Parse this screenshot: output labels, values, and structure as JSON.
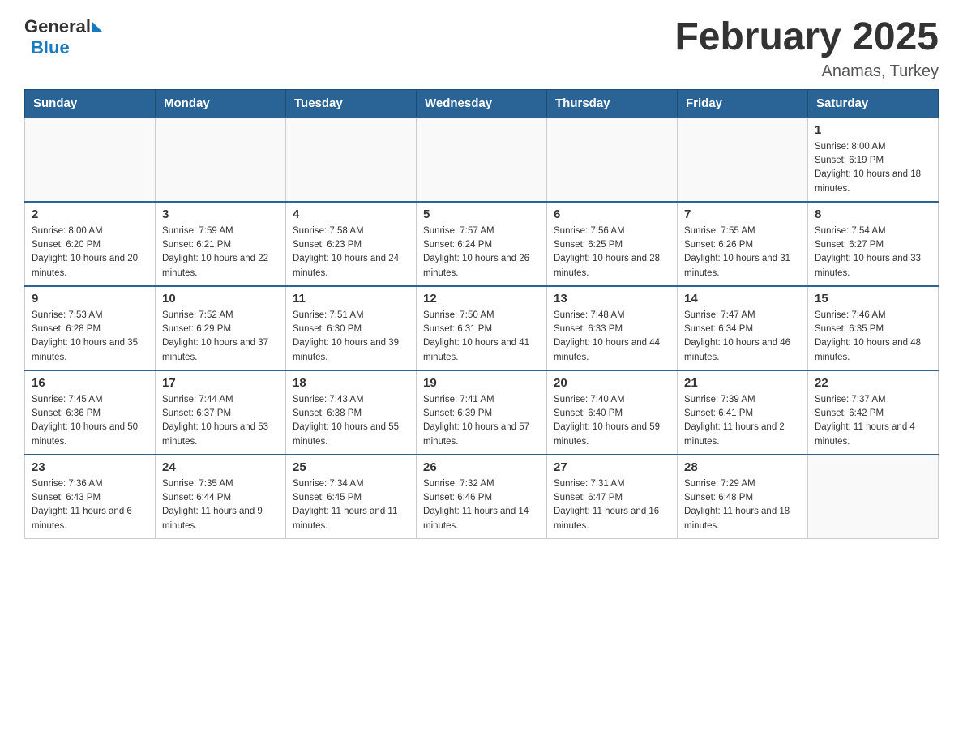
{
  "header": {
    "logo_general": "General",
    "logo_blue": "Blue",
    "title": "February 2025",
    "subtitle": "Anamas, Turkey"
  },
  "days_of_week": [
    "Sunday",
    "Monday",
    "Tuesday",
    "Wednesday",
    "Thursday",
    "Friday",
    "Saturday"
  ],
  "weeks": [
    [
      {
        "day": "",
        "info": ""
      },
      {
        "day": "",
        "info": ""
      },
      {
        "day": "",
        "info": ""
      },
      {
        "day": "",
        "info": ""
      },
      {
        "day": "",
        "info": ""
      },
      {
        "day": "",
        "info": ""
      },
      {
        "day": "1",
        "info": "Sunrise: 8:00 AM\nSunset: 6:19 PM\nDaylight: 10 hours and 18 minutes."
      }
    ],
    [
      {
        "day": "2",
        "info": "Sunrise: 8:00 AM\nSunset: 6:20 PM\nDaylight: 10 hours and 20 minutes."
      },
      {
        "day": "3",
        "info": "Sunrise: 7:59 AM\nSunset: 6:21 PM\nDaylight: 10 hours and 22 minutes."
      },
      {
        "day": "4",
        "info": "Sunrise: 7:58 AM\nSunset: 6:23 PM\nDaylight: 10 hours and 24 minutes."
      },
      {
        "day": "5",
        "info": "Sunrise: 7:57 AM\nSunset: 6:24 PM\nDaylight: 10 hours and 26 minutes."
      },
      {
        "day": "6",
        "info": "Sunrise: 7:56 AM\nSunset: 6:25 PM\nDaylight: 10 hours and 28 minutes."
      },
      {
        "day": "7",
        "info": "Sunrise: 7:55 AM\nSunset: 6:26 PM\nDaylight: 10 hours and 31 minutes."
      },
      {
        "day": "8",
        "info": "Sunrise: 7:54 AM\nSunset: 6:27 PM\nDaylight: 10 hours and 33 minutes."
      }
    ],
    [
      {
        "day": "9",
        "info": "Sunrise: 7:53 AM\nSunset: 6:28 PM\nDaylight: 10 hours and 35 minutes."
      },
      {
        "day": "10",
        "info": "Sunrise: 7:52 AM\nSunset: 6:29 PM\nDaylight: 10 hours and 37 minutes."
      },
      {
        "day": "11",
        "info": "Sunrise: 7:51 AM\nSunset: 6:30 PM\nDaylight: 10 hours and 39 minutes."
      },
      {
        "day": "12",
        "info": "Sunrise: 7:50 AM\nSunset: 6:31 PM\nDaylight: 10 hours and 41 minutes."
      },
      {
        "day": "13",
        "info": "Sunrise: 7:48 AM\nSunset: 6:33 PM\nDaylight: 10 hours and 44 minutes."
      },
      {
        "day": "14",
        "info": "Sunrise: 7:47 AM\nSunset: 6:34 PM\nDaylight: 10 hours and 46 minutes."
      },
      {
        "day": "15",
        "info": "Sunrise: 7:46 AM\nSunset: 6:35 PM\nDaylight: 10 hours and 48 minutes."
      }
    ],
    [
      {
        "day": "16",
        "info": "Sunrise: 7:45 AM\nSunset: 6:36 PM\nDaylight: 10 hours and 50 minutes."
      },
      {
        "day": "17",
        "info": "Sunrise: 7:44 AM\nSunset: 6:37 PM\nDaylight: 10 hours and 53 minutes."
      },
      {
        "day": "18",
        "info": "Sunrise: 7:43 AM\nSunset: 6:38 PM\nDaylight: 10 hours and 55 minutes."
      },
      {
        "day": "19",
        "info": "Sunrise: 7:41 AM\nSunset: 6:39 PM\nDaylight: 10 hours and 57 minutes."
      },
      {
        "day": "20",
        "info": "Sunrise: 7:40 AM\nSunset: 6:40 PM\nDaylight: 10 hours and 59 minutes."
      },
      {
        "day": "21",
        "info": "Sunrise: 7:39 AM\nSunset: 6:41 PM\nDaylight: 11 hours and 2 minutes."
      },
      {
        "day": "22",
        "info": "Sunrise: 7:37 AM\nSunset: 6:42 PM\nDaylight: 11 hours and 4 minutes."
      }
    ],
    [
      {
        "day": "23",
        "info": "Sunrise: 7:36 AM\nSunset: 6:43 PM\nDaylight: 11 hours and 6 minutes."
      },
      {
        "day": "24",
        "info": "Sunrise: 7:35 AM\nSunset: 6:44 PM\nDaylight: 11 hours and 9 minutes."
      },
      {
        "day": "25",
        "info": "Sunrise: 7:34 AM\nSunset: 6:45 PM\nDaylight: 11 hours and 11 minutes."
      },
      {
        "day": "26",
        "info": "Sunrise: 7:32 AM\nSunset: 6:46 PM\nDaylight: 11 hours and 14 minutes."
      },
      {
        "day": "27",
        "info": "Sunrise: 7:31 AM\nSunset: 6:47 PM\nDaylight: 11 hours and 16 minutes."
      },
      {
        "day": "28",
        "info": "Sunrise: 7:29 AM\nSunset: 6:48 PM\nDaylight: 11 hours and 18 minutes."
      },
      {
        "day": "",
        "info": ""
      }
    ]
  ]
}
